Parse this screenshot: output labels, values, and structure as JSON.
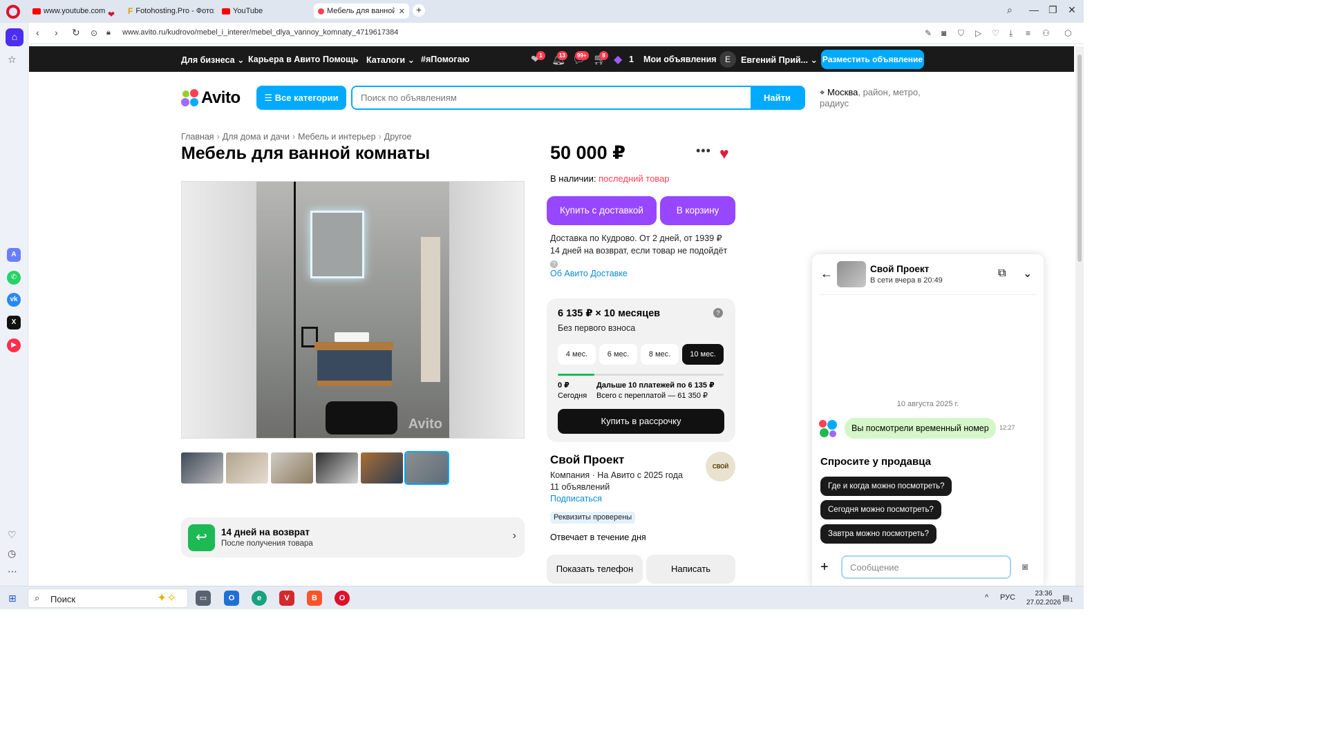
{
  "browser": {
    "tabs": [
      {
        "label": "www.youtube.com"
      },
      {
        "label": "Fotohosting.Pro - Фотохо"
      },
      {
        "label": "YouTube"
      },
      {
        "label": "Мебель для ванной комн"
      }
    ],
    "new_tab": "+",
    "url": "www.avito.ru/kudrovo/mebel_i_interer/mebel_dlya_vannoy_komnaty_4719617384"
  },
  "topnav": {
    "links": [
      "Для бизнеса ⌄",
      "Карьера в Авито",
      "Помощь",
      "Каталоги ⌄",
      "#яПомогаю"
    ],
    "badges": {
      "favorites": "1",
      "notifications": "13",
      "messages": "99+",
      "cart": "8",
      "bonus": "1"
    },
    "my_ads": "Мои объявления",
    "avatar_letter": "Е",
    "user": "Евгений Прий... ⌄",
    "post_ad": "Разместить объявление"
  },
  "header": {
    "logo": "Avito",
    "all_categories": "Все категории",
    "search_placeholder": "Поиск по объявлениям",
    "search_button": "Найти",
    "location_city": "Москва",
    "location_rest": ", район, метро, радиус"
  },
  "item": {
    "breadcrumbs": [
      "Главная",
      "Для дома и дачи",
      "Мебель и интерьер",
      "Другое"
    ],
    "title": "Мебель для ванной комнаты",
    "watermark": "Avito",
    "return_title": "14 дней на возврат",
    "return_sub": "После получения товара"
  },
  "purchase": {
    "price": "50 000 ₽",
    "availability_label": "В наличии: ",
    "availability_value": "последний товар",
    "buy_delivery": "Купить с доставкой",
    "to_cart": "В корзину",
    "delivery_line1": "Доставка по Кудрово. От 2 дней, от 1939 ₽",
    "delivery_line2": "14 дней на возврат, если товар не подойдёт",
    "about_delivery": "Об Авито Доставке"
  },
  "installment": {
    "amount": "6 135 ₽ × 10 месяцев",
    "no_down": "Без первого взноса",
    "terms": [
      "4 мес.",
      "6 мес.",
      "8 мес.",
      "10 мес."
    ],
    "selected_term": "10 мес.",
    "first_payment_fraction": 0.22,
    "today_amount": "0 ₽",
    "today_label": "Сегодня",
    "next_payments": "Дальше 10 платежей по 6 135 ₽",
    "total": "Всего с переплатой — 61 350 ₽",
    "buy": "Купить в рассрочку"
  },
  "seller": {
    "name": "Свой Проект",
    "logo_text": "СВОЙ",
    "meta": "Компания · На Авито с 2025 года",
    "ads_count": "11 объявлений",
    "subscribe": "Подписаться",
    "verified": "Реквизиты проверены",
    "responds": "Отвечает в течение дня",
    "show_phone": "Показать телефон",
    "write": "Написать"
  },
  "chat": {
    "name": "Свой Проект",
    "status": "В сети вчера в 20:49",
    "date": "10 августа 2025 г.",
    "message": "Вы посмотрели временный номер",
    "message_time": "12:27",
    "ask_title": "Спросите у продавца",
    "quick_questions": [
      "Где и когда можно посмотреть?",
      "Сегодня можно посмотреть?",
      "Завтра можно посмотреть?"
    ],
    "input_placeholder": "Сообщение"
  },
  "taskbar": {
    "search_label": "Поиск",
    "lang": "РУС",
    "time": "23:36",
    "date": "27.02.2026",
    "notif_count": "1"
  },
  "colors": {
    "accent_blue": "#00aaff",
    "purple": "#9747ff",
    "red": "#ff4053",
    "green": "#1db955"
  }
}
